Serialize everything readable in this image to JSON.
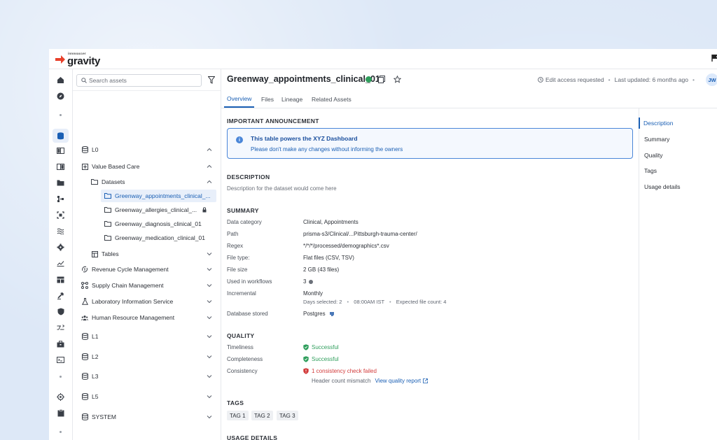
{
  "brand": {
    "sup": "innovaccer",
    "name": "gravity",
    "accent": "#e8412b"
  },
  "rail_icons": [
    "home-icon",
    "compass-icon",
    "database-icon",
    "book-icon",
    "book-open-icon",
    "folder-icon",
    "workflow-icon",
    "scan-icon",
    "waves-icon",
    "settings-puzzle-icon",
    "chart-line-icon",
    "table-icon",
    "hammer-icon",
    "shield-icon",
    "shuffle-icon",
    "briefcase-icon",
    "terminal-icon",
    "target-icon",
    "clipboard-icon"
  ],
  "sidebar": {
    "search_placeholder": "Search assets",
    "tree": {
      "l0": "L0",
      "vbc": "Value Based Care",
      "datasets": "Datasets",
      "ds1": "Greenway_appointments_clinical_...",
      "ds2": "Greenway_allergies_clinical_...",
      "ds3": "Greenway_diagnosis_clinical_01",
      "ds4": "Greenway_medication_clinical_01",
      "tables": "Tables",
      "rcm": "Revenue Cycle Management",
      "scm": "Supply Chain Management",
      "lis": "Laboratory Information Service",
      "hrm": "Human Resource Management",
      "l1": "L1",
      "l2": "L2",
      "l3": "L3",
      "l5": "L5",
      "system": "SYSTEM"
    }
  },
  "header": {
    "title": "Greenway_appointments_clinical_01",
    "status_color": "#2f9e5c",
    "access": "Edit access requested",
    "updated": "Last updated: 6 months ago",
    "avatar": "JW"
  },
  "tabs": [
    "Overview",
    "Files",
    "Lineage",
    "Related Assets"
  ],
  "announcement": {
    "heading": "IMPORTANT ANNOUNCEMENT",
    "title": "This table powers the XYZ Dashboard",
    "body": "Please don't make any changes without informing the owners"
  },
  "description": {
    "heading": "DESCRIPTION",
    "text": "Description for the dataset would come here"
  },
  "summary": {
    "heading": "SUMMARY",
    "rows": [
      {
        "k": "Data category",
        "v": "Clinical, Appointments"
      },
      {
        "k": "Path",
        "v": "prisma-s3/Clinical/...Pittsburgh-trauma-center/"
      },
      {
        "k": "Regex",
        "v": "*/*/*/processed/demographics*.csv"
      },
      {
        "k": "File type:",
        "v": "Flat files (CSV, TSV)"
      },
      {
        "k": "File size",
        "v": "2 GB (43 files)"
      },
      {
        "k": "Used in workflows",
        "v": "3"
      },
      {
        "k": "Incremental",
        "v": "Monthly"
      },
      {
        "k": "Database stored",
        "v": "Postgres"
      }
    ],
    "incremental_note": {
      "days": "Days selected: 2",
      "time": "08:00AM IST",
      "expected": "Expected file count: 4"
    }
  },
  "quality": {
    "heading": "QUALITY",
    "rows": [
      {
        "k": "Timeliness",
        "v": "Successful"
      },
      {
        "k": "Completeness",
        "v": "Successful"
      },
      {
        "k": "Consistency",
        "v": "1 consistency check failed"
      }
    ],
    "note": "Header count mismatch",
    "link": "View quality report",
    "ok_color": "#2f9e5c",
    "fail_color": "#d23b3b"
  },
  "tags": {
    "heading": "TAGS",
    "items": [
      "TAG 1",
      "TAG 2",
      "TAG 3"
    ]
  },
  "usage": {
    "heading": "USAGE DETAILS"
  },
  "toc": [
    "Description",
    "Summary",
    "Quality",
    "Tags",
    "Usage details"
  ]
}
